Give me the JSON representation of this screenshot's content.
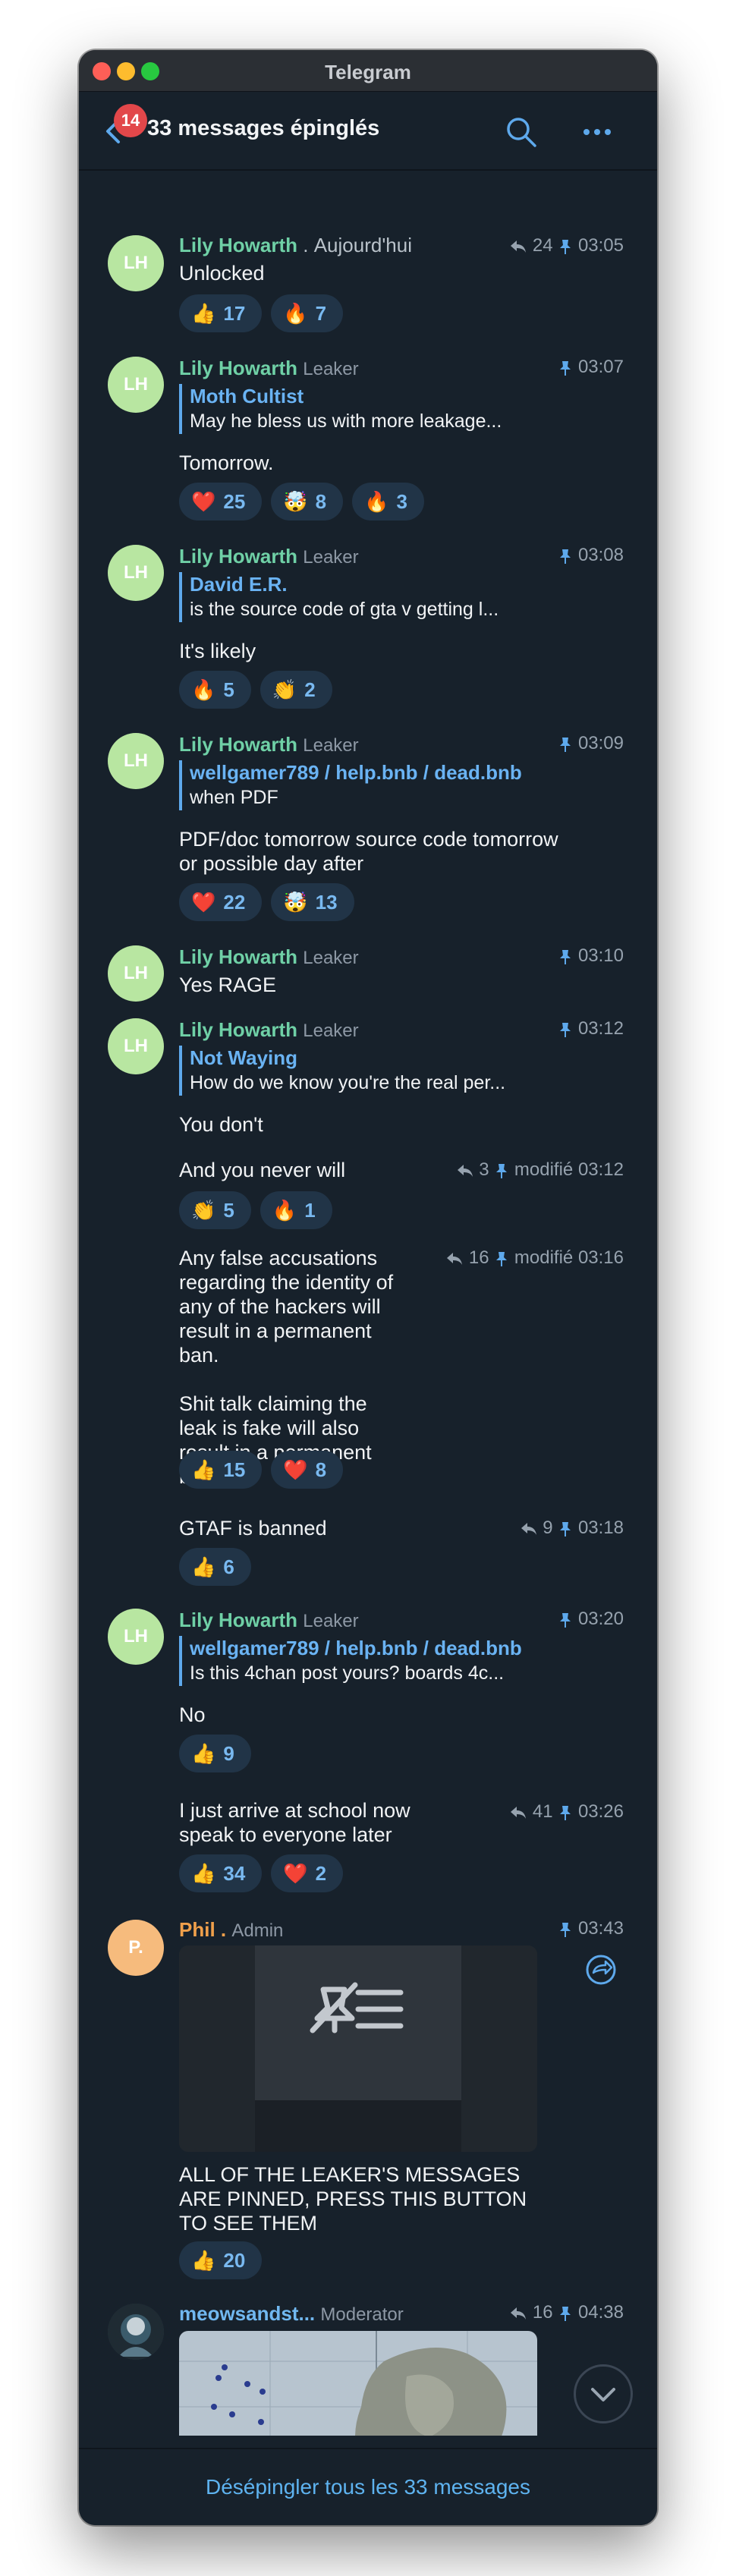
{
  "window": {
    "title": "Telegram"
  },
  "header": {
    "badge_count": "14",
    "title": "33 messages épinglés"
  },
  "messages": [
    {
      "avatar": "LH",
      "sender": "Lily Howarth",
      "separator": ".",
      "date": "Aujourd'hui",
      "meta": {
        "replies": "24",
        "time": "03:05"
      },
      "text": "Unlocked",
      "reactions": [
        {
          "emoji": "👍",
          "count": "17"
        },
        {
          "emoji": "🔥",
          "count": "7"
        }
      ]
    },
    {
      "avatar": "LH",
      "sender": "Lily Howarth",
      "role": "Leaker",
      "meta": {
        "time": "03:07"
      },
      "reply": {
        "name": "Moth Cultist",
        "text": "May he bless us with more leakage..."
      },
      "text": "Tomorrow.",
      "reactions": [
        {
          "emoji": "❤️",
          "count": "25"
        },
        {
          "emoji": "🤯",
          "count": "8"
        },
        {
          "emoji": "🔥",
          "count": "3"
        }
      ]
    },
    {
      "avatar": "LH",
      "sender": "Lily Howarth",
      "role": "Leaker",
      "meta": {
        "time": "03:08"
      },
      "reply": {
        "name": "David E.R.",
        "text": "is the source code of gta v getting l..."
      },
      "text": "It's likely",
      "reactions": [
        {
          "emoji": "🔥",
          "count": "5"
        },
        {
          "emoji": "👏",
          "count": "2"
        }
      ]
    },
    {
      "avatar": "LH",
      "sender": "Lily Howarth",
      "role": "Leaker",
      "meta": {
        "time": "03:09"
      },
      "reply": {
        "name": "wellgamer789 / help.bnb / dead.bnb",
        "text": "when PDF"
      },
      "text": "PDF/doc tomorrow source code tomorrow or possible day after",
      "reactions": [
        {
          "emoji": "❤️",
          "count": "22"
        },
        {
          "emoji": "🤯",
          "count": "13"
        }
      ]
    },
    {
      "avatar": "LH",
      "sender": "Lily Howarth",
      "role": "Leaker",
      "meta": {
        "time": "03:10"
      },
      "text": "Yes RAGE"
    },
    {
      "avatar": "LH",
      "sender": "Lily Howarth",
      "role": "Leaker",
      "meta": {
        "time": "03:12"
      },
      "reply": {
        "name": "Not Waying",
        "text": "How do we know you're the real per..."
      },
      "text": "You don't"
    },
    {
      "text": "And you never will",
      "meta": {
        "replies": "3",
        "edited": "modifié",
        "time": "03:12"
      },
      "reactions": [
        {
          "emoji": "👏",
          "count": "5"
        },
        {
          "emoji": "🔥",
          "count": "1"
        }
      ]
    },
    {
      "text_lines": [
        "Any false accusations regarding the identity of any of the hackers will result in a permanent ban.",
        "",
        "Shit talk claiming the leak is fake will also result in a permanent ban"
      ],
      "meta": {
        "replies": "16",
        "edited": "modifié",
        "time": "03:16"
      },
      "reactions": [
        {
          "emoji": "👍",
          "count": "15"
        },
        {
          "emoji": "❤️",
          "count": "8"
        }
      ]
    },
    {
      "text": "GTAF is banned",
      "meta": {
        "replies": "9",
        "time": "03:18"
      },
      "reactions": [
        {
          "emoji": "👍",
          "count": "6"
        }
      ]
    },
    {
      "avatar": "LH",
      "sender": "Lily Howarth",
      "role": "Leaker",
      "meta": {
        "time": "03:20"
      },
      "reply": {
        "name": "wellgamer789 / help.bnb / dead.bnb",
        "text": "Is this 4chan post yours?  boards 4c..."
      },
      "text": "No",
      "reactions": [
        {
          "emoji": "👍",
          "count": "9"
        }
      ]
    },
    {
      "text": "I just arrive at school now speak to everyone later",
      "meta": {
        "replies": "41",
        "time": "03:26"
      },
      "reactions": [
        {
          "emoji": "👍",
          "count": "34"
        },
        {
          "emoji": "❤️",
          "count": "2"
        }
      ]
    },
    {
      "avatar": "P.",
      "sender": "Phil .",
      "role": "Admin",
      "meta": {
        "time": "03:43"
      },
      "text": "ALL OF THE LEAKER'S MESSAGES ARE PINNED, PRESS THIS BUTTON TO SEE THEM",
      "reactions": [
        {
          "emoji": "👍",
          "count": "20"
        }
      ]
    },
    {
      "sender": "meowsandst...",
      "role": "Moderator",
      "meta": {
        "replies": "16",
        "time": "04:38"
      }
    }
  ],
  "footer": {
    "unpin_all_label": "Désépingler tous les 33 messages"
  },
  "colors": {
    "bg": "#17212b",
    "accent": "#5eb3f0",
    "reaction_bg": "#213447",
    "badge": "#e2474a",
    "name_green": "#6fd0a6",
    "name_orange": "#f0a04b"
  }
}
